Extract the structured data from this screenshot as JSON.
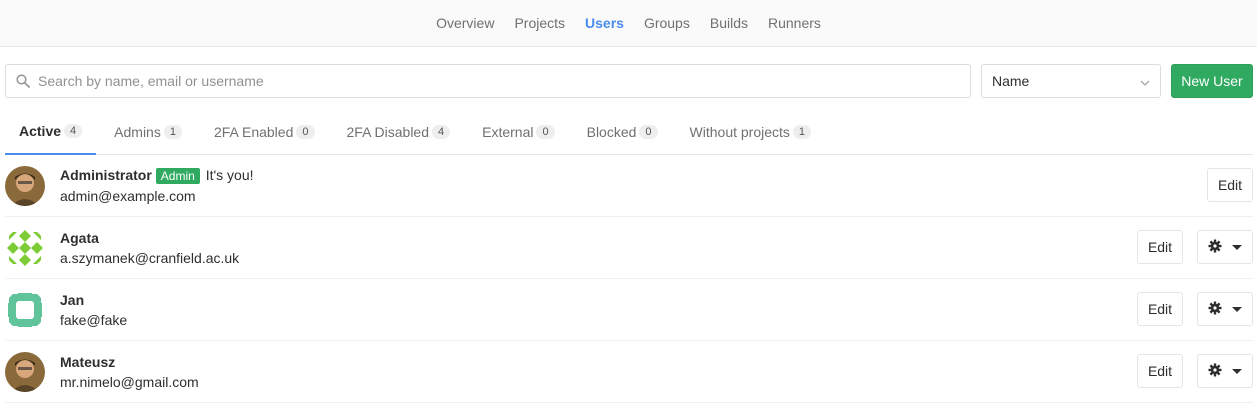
{
  "nav": {
    "items": [
      {
        "label": "Overview",
        "active": false
      },
      {
        "label": "Projects",
        "active": false
      },
      {
        "label": "Users",
        "active": true
      },
      {
        "label": "Groups",
        "active": false
      },
      {
        "label": "Builds",
        "active": false
      },
      {
        "label": "Runners",
        "active": false
      }
    ]
  },
  "search": {
    "placeholder": "Search by name, email or username",
    "value": ""
  },
  "sort": {
    "selected": "Name"
  },
  "new_user_label": "New User",
  "tabs": [
    {
      "label": "Active",
      "count": "4",
      "active": true
    },
    {
      "label": "Admins",
      "count": "1",
      "active": false
    },
    {
      "label": "2FA Enabled",
      "count": "0",
      "active": false
    },
    {
      "label": "2FA Disabled",
      "count": "4",
      "active": false
    },
    {
      "label": "External",
      "count": "0",
      "active": false
    },
    {
      "label": "Blocked",
      "count": "0",
      "active": false
    },
    {
      "label": "Without projects",
      "count": "1",
      "active": false
    }
  ],
  "users": [
    {
      "name": "Administrator",
      "badge": "Admin",
      "note": "It's you!",
      "email": "admin@example.com",
      "avatar": "photo-avatar",
      "edit": "Edit",
      "has_gear": false
    },
    {
      "name": "Agata",
      "badge": "",
      "note": "",
      "email": "a.szymanek@cranfield.ac.uk",
      "avatar": "identicon-green-diamond",
      "edit": "Edit",
      "has_gear": true
    },
    {
      "name": "Jan",
      "badge": "",
      "note": "",
      "email": "fake@fake",
      "avatar": "identicon-teal-cross",
      "edit": "Edit",
      "has_gear": true
    },
    {
      "name": "Mateusz",
      "badge": "",
      "note": "",
      "email": "mr.nimelo@gmail.com",
      "avatar": "photo-avatar",
      "edit": "Edit",
      "has_gear": true
    }
  ],
  "colors": {
    "accent": "#4a8bee",
    "success": "#2faa60",
    "identicon_green": "#7dcc35",
    "identicon_teal": "#5fc49a"
  }
}
